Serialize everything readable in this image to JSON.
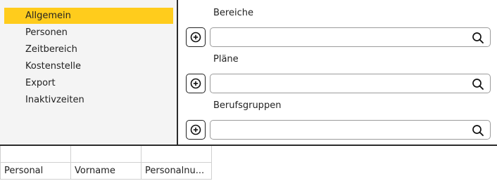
{
  "nav": {
    "items": [
      {
        "label": "Allgemein",
        "active": true
      },
      {
        "label": "Personen",
        "active": false
      },
      {
        "label": "Zeitbereich",
        "active": false
      },
      {
        "label": "Kostenstelle",
        "active": false
      },
      {
        "label": "Export",
        "active": false
      },
      {
        "label": "Inaktivzeiten",
        "active": false
      }
    ]
  },
  "sections": [
    {
      "label": "Bereiche",
      "add_icon": "plus-circle-icon",
      "search_value": "",
      "search_icon": "search-icon"
    },
    {
      "label": "Pläne",
      "add_icon": "plus-circle-icon",
      "search_value": "",
      "search_icon": "search-icon"
    },
    {
      "label": "Berufsgruppen",
      "add_icon": "plus-circle-icon",
      "search_value": "",
      "search_icon": "search-icon"
    }
  ],
  "table": {
    "filter_values": [
      "",
      "",
      ""
    ],
    "columns": [
      "Personal",
      "Vorname",
      "Personalnu..."
    ]
  },
  "colors": {
    "accent": "#ffcc1c",
    "divider": "#2b2b2b",
    "panel_bg": "#f4f4f4"
  }
}
